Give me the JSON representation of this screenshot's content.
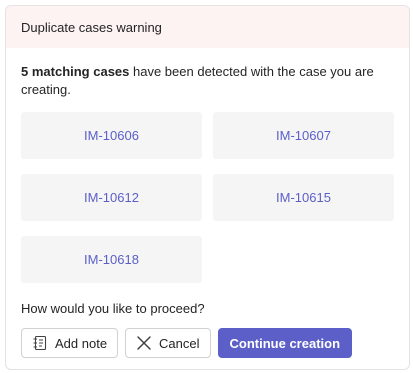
{
  "header": {
    "title": "Duplicate cases warning"
  },
  "message": {
    "count_text": "5 matching cases",
    "rest_text": " have been detected with the case you are creating."
  },
  "cases": [
    {
      "id": "IM-10606"
    },
    {
      "id": "IM-10607"
    },
    {
      "id": "IM-10612"
    },
    {
      "id": "IM-10615"
    },
    {
      "id": "IM-10618"
    }
  ],
  "prompt": "How would you like to proceed?",
  "actions": {
    "add_note_label": "Add note",
    "add_note_icon": "note-icon",
    "cancel_label": "Cancel",
    "cancel_icon": "close-icon",
    "continue_label": "Continue creation"
  },
  "colors": {
    "accent": "#5b5fc7",
    "header_background": "#fdf3f2",
    "tile_background": "#f5f5f5"
  }
}
